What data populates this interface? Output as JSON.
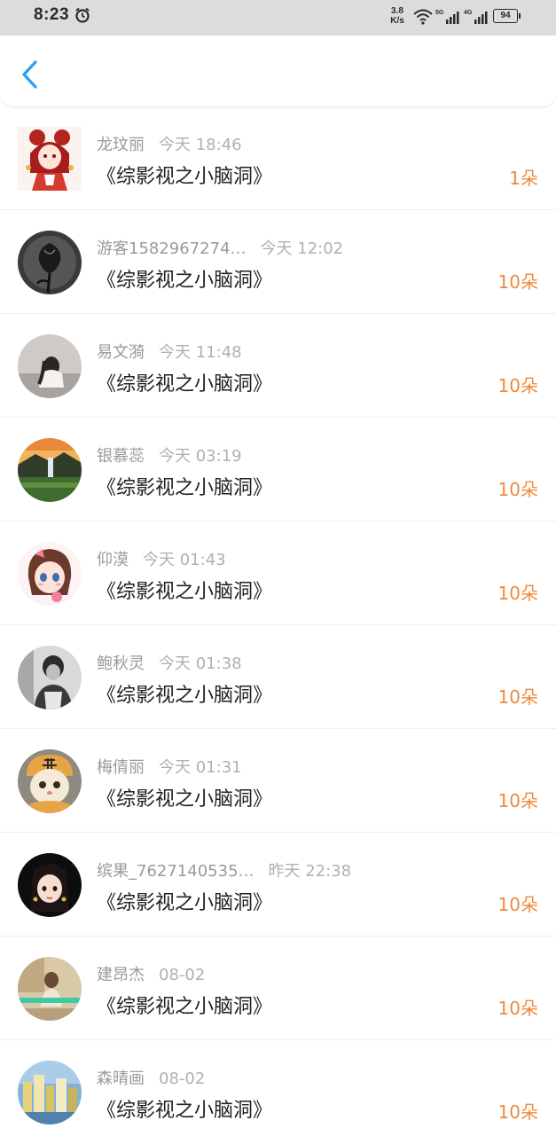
{
  "status_bar": {
    "time": "8:23",
    "net_speed_value": "3.8",
    "net_speed_unit": "K/s",
    "signal_5g": "5G",
    "signal_4g": "4G",
    "battery": "94",
    "icons": [
      "alarm-icon",
      "wifi-icon",
      "signal-icon",
      "signal-icon",
      "battery-icon"
    ]
  },
  "header": {
    "back_icon": "chevron-left-icon",
    "accent_color": "#2a9df4"
  },
  "colors": {
    "amount": "#f08a3c",
    "name": "#9a9a9a",
    "title": "#222222"
  },
  "rows": [
    {
      "name": "龙玟丽",
      "time": "今天 18:46",
      "title": "《综影视之小脑洞》",
      "amount": "1朵"
    },
    {
      "name": "游客1582967274…",
      "time": "今天 12:02",
      "title": "《综影视之小脑洞》",
      "amount": "10朵"
    },
    {
      "name": "易文漪",
      "time": "今天 11:48",
      "title": "《综影视之小脑洞》",
      "amount": "10朵"
    },
    {
      "name": "银慕蕊",
      "time": "今天 03:19",
      "title": "《综影视之小脑洞》",
      "amount": "10朵"
    },
    {
      "name": "仰漠",
      "time": "今天 01:43",
      "title": "《综影视之小脑洞》",
      "amount": "10朵"
    },
    {
      "name": "鲍秋灵",
      "time": "今天 01:38",
      "title": "《综影视之小脑洞》",
      "amount": "10朵"
    },
    {
      "name": "梅倩丽",
      "time": "今天 01:31",
      "title": "《综影视之小脑洞》",
      "amount": "10朵"
    },
    {
      "name": "缤果_7627140535…",
      "time": "昨天 22:38",
      "title": "《综影视之小脑洞》",
      "amount": "10朵"
    },
    {
      "name": "建昂杰",
      "time": "08-02",
      "title": "《综影视之小脑洞》",
      "amount": "10朵"
    },
    {
      "name": "森晴画",
      "time": "08-02",
      "title": "《综影视之小脑洞》",
      "amount": "10朵"
    }
  ]
}
